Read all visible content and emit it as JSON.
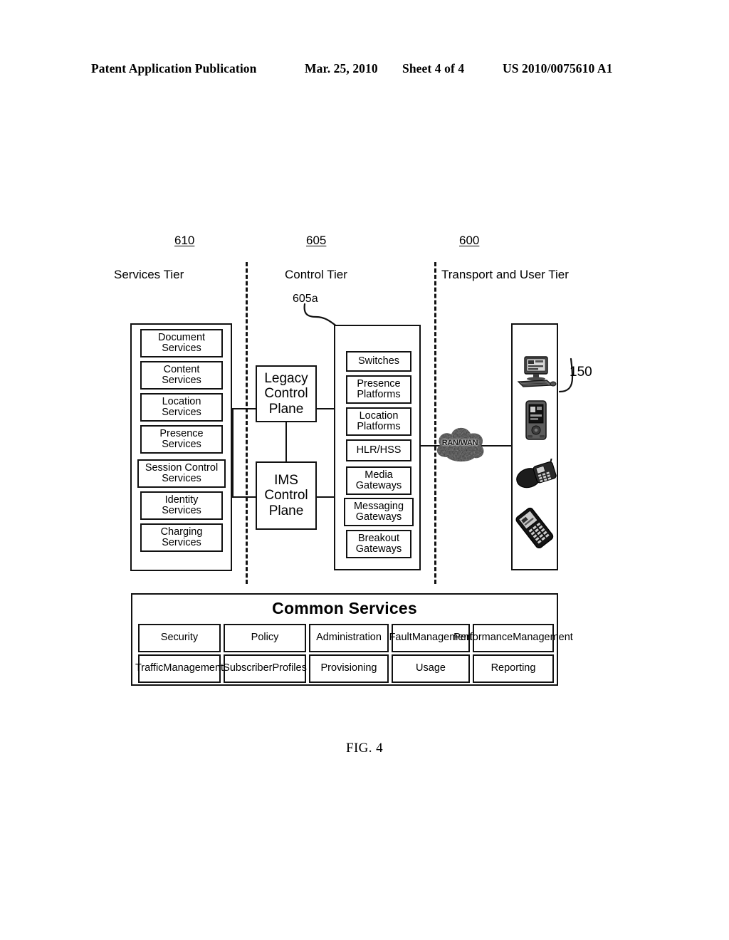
{
  "header": {
    "publication": "Patent Application Publication",
    "date": "Mar. 25, 2010",
    "sheet": "Sheet 4 of 4",
    "patent_number": "US 2010/0075610 A1"
  },
  "figure": {
    "caption": "FIG. 4"
  },
  "tiers": {
    "services": {
      "ref": "610",
      "label": "Services Tier"
    },
    "control": {
      "ref": "605",
      "label": "Control Tier",
      "sub_ref": "605a"
    },
    "transport": {
      "ref": "600",
      "label": "Transport and User Tier"
    }
  },
  "services_tier": {
    "boxes": [
      {
        "line1": "Document",
        "line2": "Services"
      },
      {
        "line1": "Content",
        "line2": "Services"
      },
      {
        "line1": "Location",
        "line2": "Services"
      },
      {
        "line1": "Presence",
        "line2": "Services"
      },
      {
        "line1": "Session Control",
        "line2": "Services"
      },
      {
        "line1": "Identity",
        "line2": "Services"
      },
      {
        "line1": "Charging",
        "line2": "Services"
      }
    ]
  },
  "control_tier": {
    "boxes": [
      {
        "line1": "Legacy",
        "line2": "Control",
        "line3": "Plane"
      },
      {
        "line1": "IMS",
        "line2": "Control",
        "line3": "Plane"
      }
    ]
  },
  "transport_tier": {
    "boxes": [
      {
        "line1": "Switches",
        "line2": ""
      },
      {
        "line1": "Presence",
        "line2": "Platforms"
      },
      {
        "line1": "Location",
        "line2": "Platforms"
      },
      {
        "line1": "HLR/HSS",
        "line2": ""
      },
      {
        "line1": "Media",
        "line2": "Gateways"
      },
      {
        "line1": "Messaging",
        "line2": "Gateways"
      },
      {
        "line1": "Breakout",
        "line2": "Gateways"
      }
    ]
  },
  "network": {
    "cloud_label": "RAN/WAN"
  },
  "user_devices": {
    "ref": "150",
    "items": [
      {
        "icon": "desktop-computer-icon"
      },
      {
        "icon": "pda-handheld-icon"
      },
      {
        "icon": "cordless-phone-icon"
      },
      {
        "icon": "mobile-flip-phone-icon"
      }
    ]
  },
  "common_services": {
    "title": "Common Services",
    "row1": [
      "Security",
      "Policy",
      "Administration",
      "Fault Management",
      "Performance Management"
    ],
    "row2": [
      "Traffic Management",
      "Subscriber Profiles",
      "Provisioning",
      "Usage",
      "Reporting"
    ],
    "row1_lines": [
      {
        "line1": "Security",
        "line2": ""
      },
      {
        "line1": "Policy",
        "line2": ""
      },
      {
        "line1": "Administration",
        "line2": ""
      },
      {
        "line1": "Fault",
        "line2": "Management"
      },
      {
        "line1": "Performance",
        "line2": "Management"
      }
    ],
    "row2_lines": [
      {
        "line1": "Traffic",
        "line2": "Management"
      },
      {
        "line1": "Subscriber",
        "line2": "Profiles"
      },
      {
        "line1": "Provisioning",
        "line2": ""
      },
      {
        "line1": "Usage",
        "line2": ""
      },
      {
        "line1": "Reporting",
        "line2": ""
      }
    ]
  },
  "colors": {
    "ink": "#111111",
    "paper": "#ffffff"
  }
}
